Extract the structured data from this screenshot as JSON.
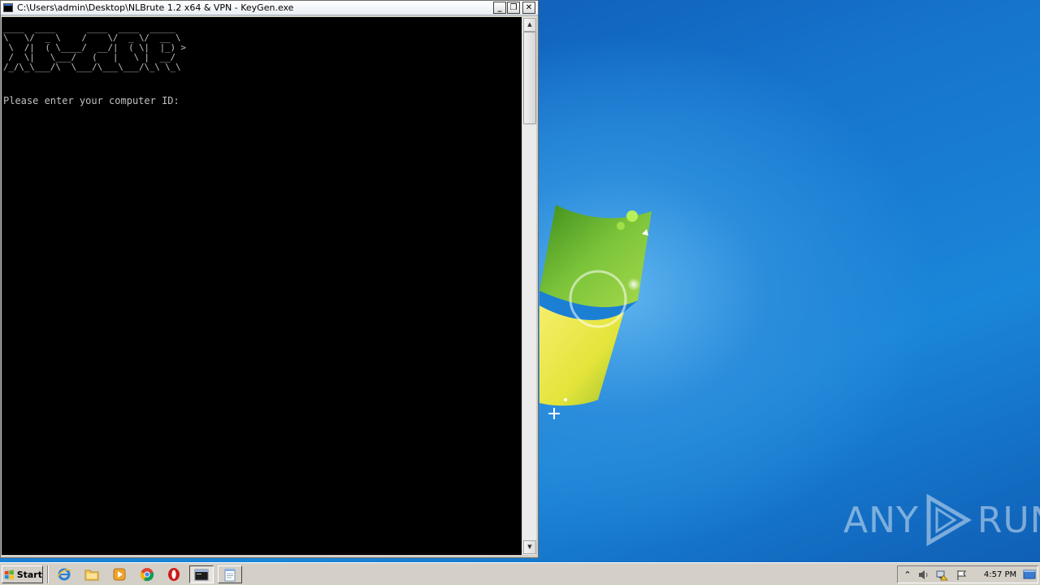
{
  "console_window": {
    "title": "C:\\Users\\admin\\Desktop\\NLBrute 1.2 x64 & VPN - KeyGen.exe",
    "minimize_glyph": "_",
    "maximize_glyph": "❐",
    "close_glyph": "✕",
    "ascii_banner": "____  ____      ____  ____  _____\n\\   \\/  _ \\    /    \\/  _ \\/  __ \\\n \\  /|  ( \\____/  __/|  ( \\|  |_) >\n /  \\|   \\___/   (   |   \\ |  __/\n/_/\\_\\___/\\  \\___/\\___\\___/\\_\\ \\_\\",
    "prompt": "Please enter your computer ID:"
  },
  "scrollbar": {
    "up_glyph": "▲",
    "down_glyph": "▼"
  },
  "watermark": {
    "text_left": "ANY",
    "text_right": "RUN"
  },
  "taskbar": {
    "start_label": "Start",
    "pinned": [
      {
        "name": "internet-explorer-icon"
      },
      {
        "name": "file-explorer-icon"
      },
      {
        "name": "media-player-icon"
      },
      {
        "name": "chrome-icon"
      },
      {
        "name": "opera-icon"
      }
    ],
    "tasks": [
      {
        "name": "console-task",
        "active": true
      },
      {
        "name": "notepad-task",
        "active": false
      }
    ],
    "tray": {
      "show_hidden_glyph": "⌃",
      "volume_glyph": "🔈",
      "clock": "4:57 PM"
    }
  },
  "colors": {
    "console_bg": "#000000",
    "console_text": "#c0c0c0",
    "desktop_blue": "#1a75c9",
    "taskbar": "#d4d0c8"
  }
}
